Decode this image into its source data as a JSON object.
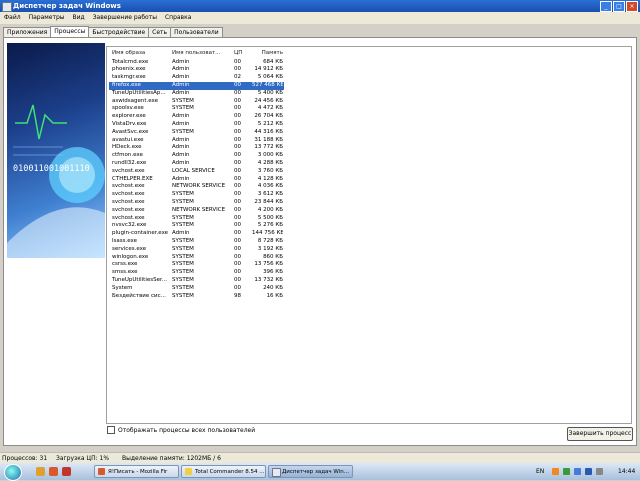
{
  "window": {
    "title": "Диспетчер задач Windows"
  },
  "menu": [
    "Файл",
    "Параметры",
    "Вид",
    "Завершение работы",
    "Справка"
  ],
  "tabs": [
    {
      "label": "Приложения",
      "active": false
    },
    {
      "label": "Процессы",
      "active": true
    },
    {
      "label": "Быстродействие",
      "active": false
    },
    {
      "label": "Сеть",
      "active": false
    },
    {
      "label": "Пользователи",
      "active": false
    }
  ],
  "side_image_text": "010011001001110",
  "columns": {
    "name": "Имя образа",
    "user": "Имя пользоват...",
    "cpu": "ЦП",
    "mem": "Память"
  },
  "processes": [
    {
      "name": "Totalcmd.exe",
      "user": "Admin",
      "cpu": "00",
      "mem": "684 КБ"
    },
    {
      "name": "phoenix.exe",
      "user": "Admin",
      "cpu": "00",
      "mem": "14 912 КБ"
    },
    {
      "name": "taskmgr.exe",
      "user": "Admin",
      "cpu": "02",
      "mem": "5 064 КБ"
    },
    {
      "name": "firefox.exe",
      "user": "Admin",
      "cpu": "00",
      "mem": "527 468 КБ",
      "selected": true
    },
    {
      "name": "TuneUpUtilitiesAp...",
      "user": "Admin",
      "cpu": "00",
      "mem": "5 400 КБ"
    },
    {
      "name": "aswidsagent.exe",
      "user": "SYSTEM",
      "cpu": "00",
      "mem": "24 456 КБ"
    },
    {
      "name": "spoolsv.exe",
      "user": "SYSTEM",
      "cpu": "00",
      "mem": "4 472 КБ"
    },
    {
      "name": "explorer.exe",
      "user": "Admin",
      "cpu": "00",
      "mem": "26 704 КБ"
    },
    {
      "name": "VistaDrv.exe",
      "user": "Admin",
      "cpu": "00",
      "mem": "5 212 КБ"
    },
    {
      "name": "AvastSvc.exe",
      "user": "SYSTEM",
      "cpu": "00",
      "mem": "44 316 КБ"
    },
    {
      "name": "avastui.exe",
      "user": "Admin",
      "cpu": "00",
      "mem": "31 188 КБ"
    },
    {
      "name": "HDeck.exe",
      "user": "Admin",
      "cpu": "00",
      "mem": "13 772 КБ"
    },
    {
      "name": "ctfmon.exe",
      "user": "Admin",
      "cpu": "00",
      "mem": "3 000 КБ"
    },
    {
      "name": "rundll32.exe",
      "user": "Admin",
      "cpu": "00",
      "mem": "4 288 КБ"
    },
    {
      "name": "svchost.exe",
      "user": "LOCAL SERVICE",
      "cpu": "00",
      "mem": "3 760 КБ"
    },
    {
      "name": "CTHELPER.EXE",
      "user": "Admin",
      "cpu": "00",
      "mem": "4 128 КБ"
    },
    {
      "name": "svchost.exe",
      "user": "NETWORK SERVICE",
      "cpu": "00",
      "mem": "4 036 КБ"
    },
    {
      "name": "svchost.exe",
      "user": "SYSTEM",
      "cpu": "00",
      "mem": "3 612 КБ"
    },
    {
      "name": "svchost.exe",
      "user": "SYSTEM",
      "cpu": "00",
      "mem": "23 844 КБ"
    },
    {
      "name": "svchost.exe",
      "user": "NETWORK SERVICE",
      "cpu": "00",
      "mem": "4 200 КБ"
    },
    {
      "name": "svchost.exe",
      "user": "SYSTEM",
      "cpu": "00",
      "mem": "5 500 КБ"
    },
    {
      "name": "nvsvc32.exe",
      "user": "SYSTEM",
      "cpu": "00",
      "mem": "5 276 КБ"
    },
    {
      "name": "plugin-container.exe",
      "user": "Admin",
      "cpu": "00",
      "mem": "144 756 КБ"
    },
    {
      "name": "lsass.exe",
      "user": "SYSTEM",
      "cpu": "00",
      "mem": "8 728 КБ"
    },
    {
      "name": "services.exe",
      "user": "SYSTEM",
      "cpu": "00",
      "mem": "3 192 КБ"
    },
    {
      "name": "winlogon.exe",
      "user": "SYSTEM",
      "cpu": "00",
      "mem": "860 КБ"
    },
    {
      "name": "csrss.exe",
      "user": "SYSTEM",
      "cpu": "00",
      "mem": "13 756 КБ"
    },
    {
      "name": "smss.exe",
      "user": "SYSTEM",
      "cpu": "00",
      "mem": "396 КБ"
    },
    {
      "name": "TuneUpUtilitiesSer...",
      "user": "SYSTEM",
      "cpu": "00",
      "mem": "13 732 КБ"
    },
    {
      "name": "System",
      "user": "SYSTEM",
      "cpu": "00",
      "mem": "240 КБ"
    },
    {
      "name": "Бездействие сис...",
      "user": "SYSTEM",
      "cpu": "98",
      "mem": "16 КБ"
    }
  ],
  "show_all_label": "Отображать процессы всех пользователей",
  "end_process_label": "Завершить процесс",
  "status": {
    "processes": "Процессов: 31",
    "cpu": "Загрузка ЦП: 1%",
    "memory": "Выделение памяти: 1202МБ / 6"
  },
  "taskbar": {
    "tasks": [
      {
        "label": "Я!Писать - Mozilla Fir",
        "active": false
      },
      {
        "label": "Total Commander 8.54 ...",
        "active": false
      },
      {
        "label": "Диспетчер задач Win...",
        "active": true
      }
    ],
    "lang": "EN",
    "time": "14:44"
  }
}
